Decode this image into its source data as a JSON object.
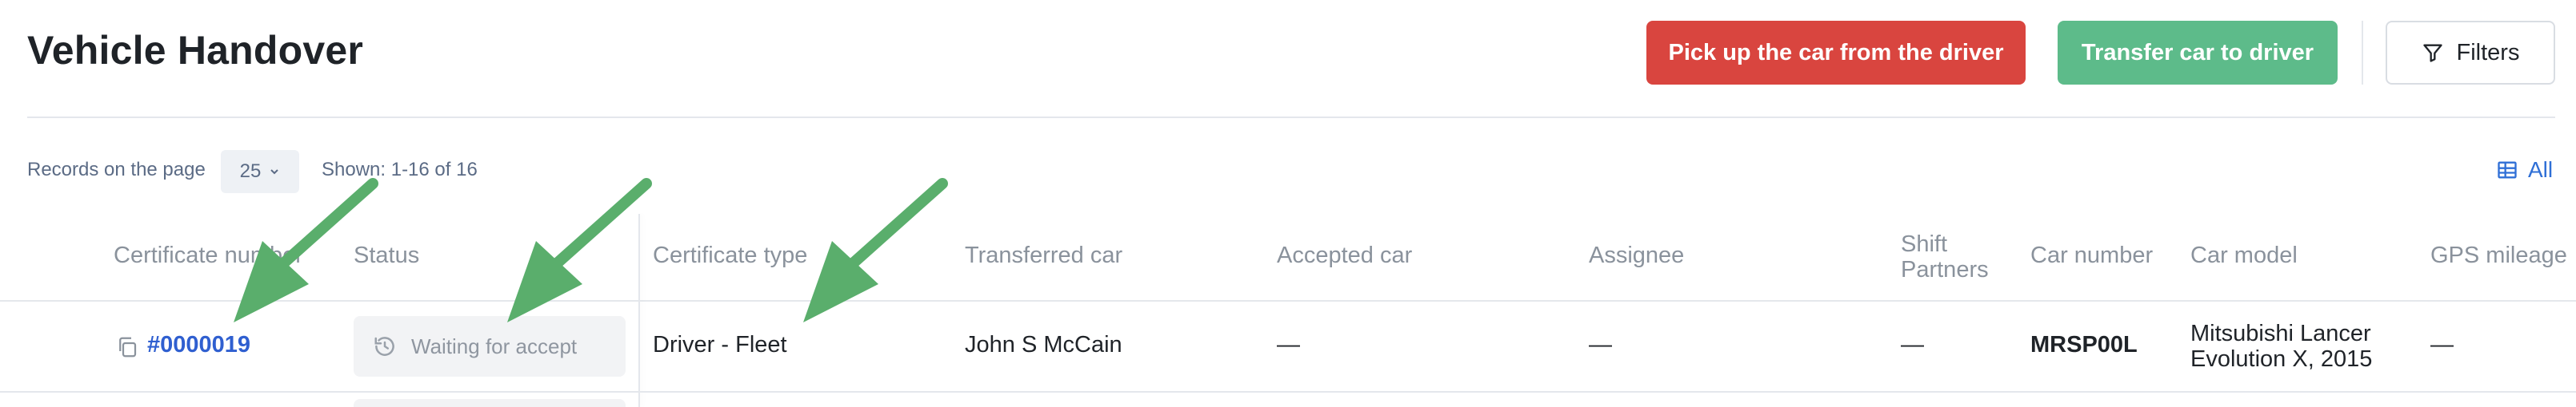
{
  "header": {
    "title": "Vehicle Handover",
    "pickup_label": "Pick up the car from the driver",
    "transfer_label": "Transfer car to driver",
    "filters_label": "Filters"
  },
  "toolbar": {
    "records_label": "Records on the page",
    "page_size": "25",
    "shown_label": "Shown: 1-16 of 16",
    "all_label": "All"
  },
  "table": {
    "columns": {
      "certificate_number": "Certificate number",
      "status": "Status",
      "certificate_type": "Certificate type",
      "transferred_car": "Transferred car",
      "accepted_car": "Accepted car",
      "assignee": "Assignee",
      "shift_partners_line1": "Shift",
      "shift_partners_line2": "Partners",
      "car_number": "Car number",
      "car_model": "Car model",
      "gps_mileage": "GPS mileage"
    },
    "rows": [
      {
        "certificate_number": "#0000019",
        "status": "Waiting for accept",
        "certificate_type": "Driver - Fleet",
        "transferred_car": "John S McCain",
        "accepted_car": "—",
        "assignee": "—",
        "shift_partners": "—",
        "car_number": "MRSP00L",
        "car_model_line1": "Mitsubishi Lancer",
        "car_model_line2": "Evolution X, 2015",
        "gps_mileage": "—"
      }
    ]
  },
  "colors": {
    "pickup_button": "#d9453f",
    "transfer_button": "#5dbb8a",
    "link": "#2f5fd0",
    "annotation_arrow": "#5aae6c"
  },
  "icons": [
    "filter-icon",
    "chevron-down-icon",
    "table-columns-icon",
    "copy-icon",
    "history-icon",
    "annotation-arrow"
  ]
}
